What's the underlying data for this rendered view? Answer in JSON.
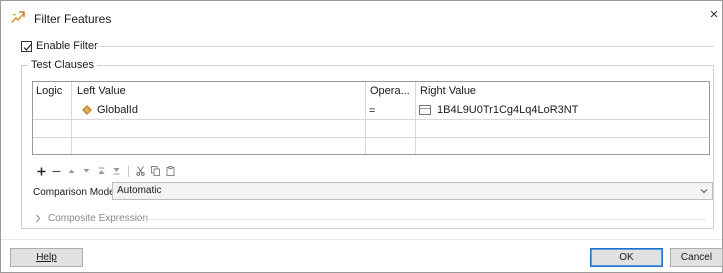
{
  "window": {
    "title": "Filter Features",
    "close_glyph": "×"
  },
  "enable_filter": {
    "label": "Enable Filter",
    "checked": true
  },
  "test_clauses": {
    "group_title": "Test Clauses",
    "columns": [
      "Logic",
      "Left Value",
      "Opera...",
      "Right Value"
    ],
    "rows": [
      {
        "logic": "",
        "left_value": "GlobalId",
        "left_icon": "attribute-icon",
        "operator": "=",
        "right_value": "1B4L9U0Tr1Cg4Lq4LoR3NT",
        "right_icon": "text-value-icon"
      }
    ]
  },
  "toolbar": {
    "items": [
      "add-icon",
      "remove-icon",
      "move-up-icon",
      "move-down-icon",
      "move-top-icon",
      "move-bottom-icon",
      "cut-icon",
      "copy-icon",
      "paste-icon"
    ]
  },
  "comparison_mode": {
    "label": "Comparison Mode:",
    "value": "Automatic"
  },
  "composite_expression": {
    "label": "Composite Expression",
    "expanded": false
  },
  "buttons": {
    "help": "Help",
    "ok": "OK",
    "cancel": "Cancel"
  },
  "colors": {
    "attribute_icon": "#c58a2e",
    "app_icon": "#d98c1f",
    "ok_border": "#1e70c8"
  }
}
